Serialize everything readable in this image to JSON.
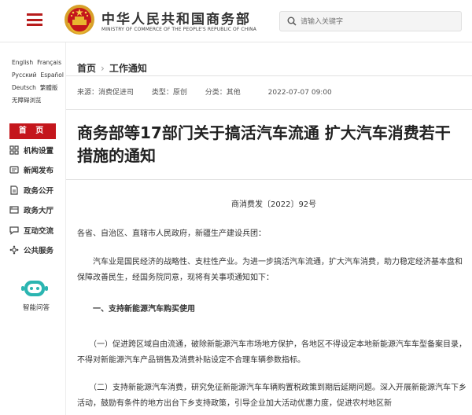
{
  "header": {
    "title": "中华人民共和国商务部",
    "subtitle": "MINISTRY OF COMMERCE OF THE PEOPLE'S REPUBLIC OF CHINA",
    "search_placeholder": "请输入关键字"
  },
  "sidebar": {
    "languages": [
      "English",
      "Français",
      "Русский",
      "Español",
      "Deutsch",
      "繁體版",
      "无障碍浏览"
    ],
    "home": "首 页",
    "items": [
      {
        "label": "机构设置",
        "icon": "organization-icon"
      },
      {
        "label": "新闻发布",
        "icon": "news-icon"
      },
      {
        "label": "政务公开",
        "icon": "document-icon"
      },
      {
        "label": "政务大厅",
        "icon": "hall-icon"
      },
      {
        "label": "互动交流",
        "icon": "chat-icon"
      },
      {
        "label": "公共服务",
        "icon": "service-icon"
      }
    ],
    "assistant_label": "智能问答"
  },
  "main": {
    "breadcrumb": [
      "首页",
      "工作通知"
    ],
    "meta": {
      "source": "来源：消费促进司",
      "type": "类型：原创",
      "category": "分类：其他",
      "date": "2022-07-07 09:00"
    },
    "title": "商务部等17部门关于搞活汽车流通 扩大汽车消费若干措施的通知",
    "doc_number": "商消费发〔2022〕92号",
    "paragraphs": [
      "各省、自治区、直辖市人民政府，新疆生产建设兵团：",
      "　　汽车业是国民经济的战略性、支柱性产业。为进一步搞活汽车流通，扩大汽车消费，助力稳定经济基本盘和保障改善民生，经国务院同意，现将有关事项通知如下：",
      "　　一、支持新能源汽车购买使用",
      "　　（一）促进跨区域自由流通，破除新能源汽车市场地方保护，各地区不得设定本地新能源汽车车型备案目录，不得对新能源汽车产品销售及消费补贴设定不合理车辆参数指标。",
      "　　（二）支持新能源汽车消费，研究免征新能源汽车车辆购置税政策到期后延期问题。深入开展新能源汽车下乡活动，鼓励有条件的地方出台下乡支持政策，引导企业加大活动优惠力度，促进农村地区新"
    ]
  },
  "colors": {
    "brand_red": "#c4161c"
  }
}
